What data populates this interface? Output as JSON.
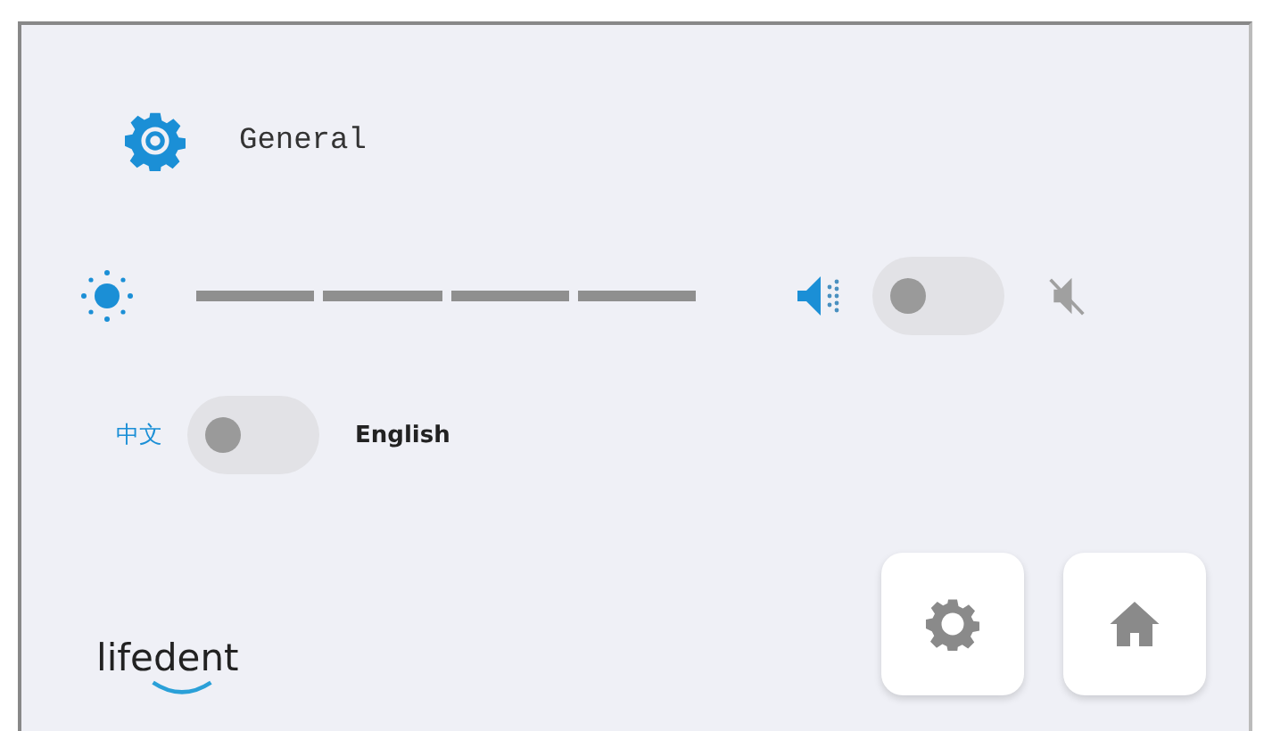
{
  "header": {
    "title": "General"
  },
  "sound": {
    "on": false
  },
  "language": {
    "left_label": "中文",
    "right_label": "English",
    "on": false
  },
  "logo": {
    "text": "lifedent"
  },
  "buttons": [
    {
      "kind": "settings"
    },
    {
      "kind": "home"
    }
  ]
}
